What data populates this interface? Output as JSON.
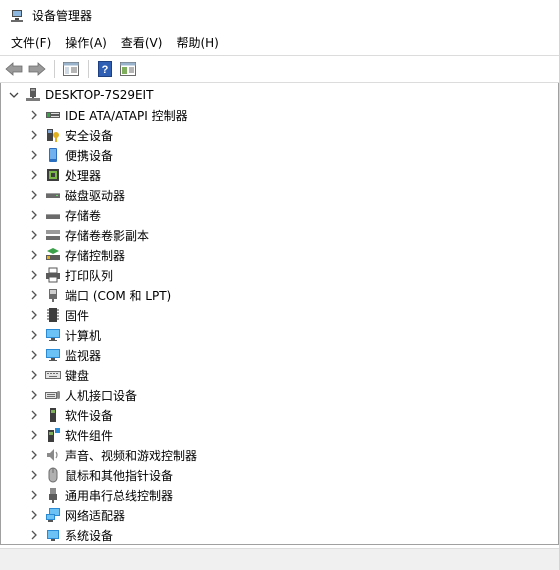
{
  "window": {
    "title": "设备管理器",
    "title_icon": "device-manager-icon"
  },
  "menu": [
    {
      "label": "文件(F)"
    },
    {
      "label": "操作(A)"
    },
    {
      "label": "查看(V)"
    },
    {
      "label": "帮助(H)"
    }
  ],
  "toolbar": {
    "buttons": [
      "back-arrow-icon",
      "forward-arrow-icon",
      "properties-icon",
      "help-icon",
      "console-tree-icon"
    ]
  },
  "tree": {
    "root": {
      "label": "DESKTOP-7S29EIT",
      "icon": "computer-root-icon",
      "expanded": true
    },
    "items": [
      {
        "label": "IDE ATA/ATAPI 控制器",
        "icon": "ide-controller-icon"
      },
      {
        "label": "安全设备",
        "icon": "security-device-icon"
      },
      {
        "label": "便携设备",
        "icon": "portable-device-icon"
      },
      {
        "label": "处理器",
        "icon": "processor-icon"
      },
      {
        "label": "磁盘驱动器",
        "icon": "disk-drive-icon"
      },
      {
        "label": "存储卷",
        "icon": "storage-volume-icon"
      },
      {
        "label": "存储卷卷影副本",
        "icon": "shadow-copy-icon"
      },
      {
        "label": "存储控制器",
        "icon": "storage-controller-icon"
      },
      {
        "label": "打印队列",
        "icon": "printer-icon"
      },
      {
        "label": "端口 (COM 和 LPT)",
        "icon": "port-icon"
      },
      {
        "label": "固件",
        "icon": "firmware-icon"
      },
      {
        "label": "计算机",
        "icon": "computer-icon"
      },
      {
        "label": "监视器",
        "icon": "monitor-icon"
      },
      {
        "label": "键盘",
        "icon": "keyboard-icon"
      },
      {
        "label": "人机接口设备",
        "icon": "hid-icon"
      },
      {
        "label": "软件设备",
        "icon": "software-device-icon"
      },
      {
        "label": "软件组件",
        "icon": "software-component-icon"
      },
      {
        "label": "声音、视频和游戏控制器",
        "icon": "sound-icon"
      },
      {
        "label": "鼠标和其他指针设备",
        "icon": "mouse-icon"
      },
      {
        "label": "通用串行总线控制器",
        "icon": "usb-icon"
      },
      {
        "label": "网络适配器",
        "icon": "network-adapter-icon"
      },
      {
        "label": "系统设备",
        "icon": "system-device-icon"
      }
    ]
  }
}
